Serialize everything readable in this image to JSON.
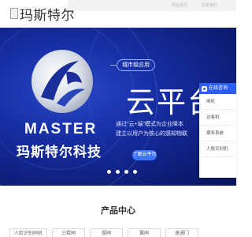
{
  "header": {
    "logo_text": "玛斯特尔",
    "topbar_links": [
      "网站首页",
      "联系我们"
    ]
  },
  "banner": {
    "brand_en": "MASTER",
    "brand_cn": "玛斯特尔科技",
    "tag": "城市级应用",
    "title": "云平台",
    "desc_lines": [
      "通过\"云+端\"模式为企业降本",
      "建立以用户为核心的感知物联"
    ],
    "cta": "了解云平台",
    "slide_count": 4,
    "colors": {
      "background": "#172fa5",
      "accent": "#3f72ff"
    }
  },
  "side_panel": {
    "title": "在线咨询",
    "items": [
      "闸机",
      "访客机",
      "票务系统",
      "人脸识别机"
    ]
  },
  "products": {
    "title": "产品中心",
    "categories": [
      "人脸识别闸机",
      "三辊闸",
      "摆闸",
      "翼闸",
      "速通门"
    ]
  }
}
